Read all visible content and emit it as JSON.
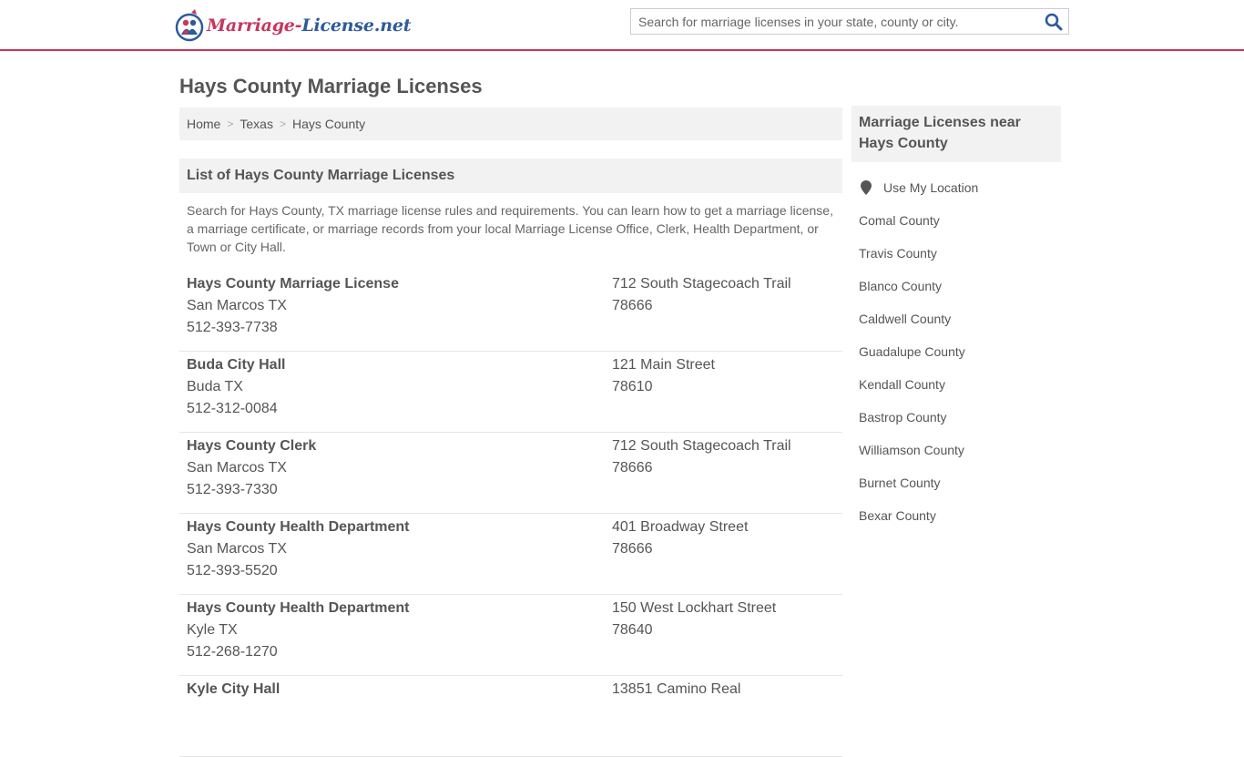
{
  "header": {
    "logo_part1": "Marriage-",
    "logo_part2": "License.net",
    "search_placeholder": "Search for marriage licenses in your state, county or city.",
    "search_icon": "magnifier-icon",
    "colors": {
      "brand_pink": "#c7365f",
      "brand_blue": "#2d5a9c"
    }
  },
  "page": {
    "title": "Hays County Marriage Licenses",
    "breadcrumb": [
      "Home",
      "Texas",
      "Hays County"
    ],
    "breadcrumb_sep": ">",
    "list_title": "List of Hays County Marriage Licenses",
    "intro": "Search for Hays County, TX marriage license rules and requirements. You can learn how to get a marriage license, a marriage certificate, or marriage records from your local Marriage License Office, Clerk, Health Department, or Town or City Hall."
  },
  "listings": [
    {
      "name": "Hays County Marriage License",
      "city": "San Marcos TX",
      "phone": "512-393-7738",
      "street": "712 South Stagecoach Trail",
      "zip": "78666"
    },
    {
      "name": "Buda City Hall",
      "city": "Buda TX",
      "phone": "512-312-0084",
      "street": "121 Main Street",
      "zip": "78610"
    },
    {
      "name": "Hays County Clerk",
      "city": "San Marcos TX",
      "phone": "512-393-7330",
      "street": "712 South Stagecoach Trail",
      "zip": "78666"
    },
    {
      "name": "Hays County Health Department",
      "city": "San Marcos TX",
      "phone": "512-393-5520",
      "street": "401 Broadway Street",
      "zip": "78666"
    },
    {
      "name": "Hays County Health Department",
      "city": "Kyle TX",
      "phone": "512-268-1270",
      "street": "150 West Lockhart Street",
      "zip": "78640"
    },
    {
      "name": "Kyle City Hall",
      "city": "",
      "phone": "",
      "street": "13851 Camino Real",
      "zip": ""
    }
  ],
  "sidebar": {
    "title": "Marriage Licenses near Hays County",
    "use_location": "Use My Location",
    "location_icon": "map-pin-icon",
    "counties": [
      "Comal County",
      "Travis County",
      "Blanco County",
      "Caldwell County",
      "Guadalupe County",
      "Kendall County",
      "Bastrop County",
      "Williamson County",
      "Burnet County",
      "Bexar County"
    ]
  }
}
